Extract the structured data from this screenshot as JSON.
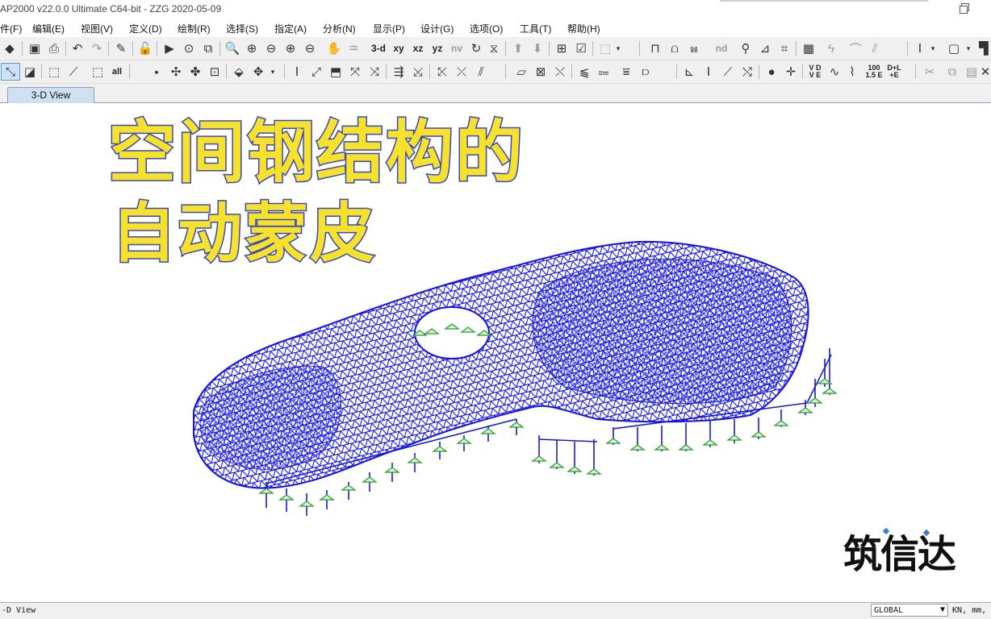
{
  "window": {
    "title": "AP2000 v22.0.0 Ultimate C64-bit - ZZG 2020-05-09"
  },
  "menu": [
    {
      "label": "件(F)"
    },
    {
      "label": "编辑(E)"
    },
    {
      "label": "视图(V)"
    },
    {
      "label": "定义(D)"
    },
    {
      "label": "绘制(R)"
    },
    {
      "label": "选择(S)"
    },
    {
      "label": "指定(A)"
    },
    {
      "label": "分析(N)"
    },
    {
      "label": "显示(P)"
    },
    {
      "label": "设计(G)"
    },
    {
      "label": "选项(O)"
    },
    {
      "label": "工具(T)"
    },
    {
      "label": "帮助(H)"
    }
  ],
  "toolbar": {
    "view_3d": "3-d",
    "view_xy": "xy",
    "view_xz": "xz",
    "view_yz": "yz",
    "view_nv": "nv",
    "nd_label": "nd",
    "all_label": "all",
    "combo_100": "100",
    "combo_15e": "1.5 E",
    "combo_dl": "D+L",
    "combo_e": "+E",
    "vd_label": "V D",
    "ve_label": "V E"
  },
  "tabs": [
    {
      "label": "3-D View"
    }
  ],
  "overlay": {
    "line1": "空间钢结构的",
    "line2": "自动蒙皮"
  },
  "watermark": {
    "text": "筑信达"
  },
  "statusbar": {
    "left": "-D View",
    "coord_system": "GLOBAL",
    "units": "KN, mm,"
  },
  "colors": {
    "mesh": "#1212e8",
    "supports": "#2a9a2a",
    "overlay_fill": "#f6e12c",
    "overlay_stroke": "#3a47b8"
  }
}
